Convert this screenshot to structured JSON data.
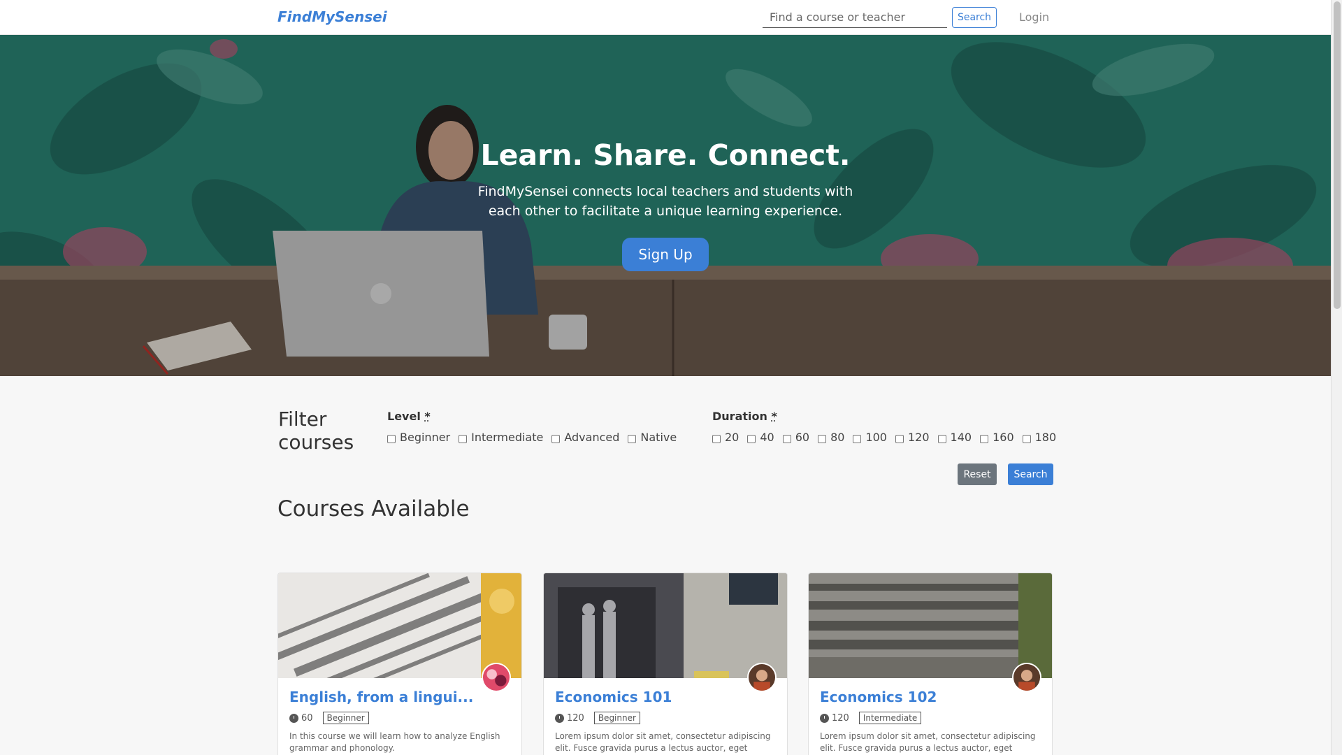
{
  "navbar": {
    "brand": "FindMySensei",
    "search_placeholder": "Find a course or teacher",
    "search_button": "Search",
    "login": "Login"
  },
  "hero": {
    "title": "Learn. Share. Connect.",
    "subtitle": "FindMySensei connects local teachers and students with each other to facilitate a unique learning experience.",
    "signup": "Sign Up"
  },
  "filter": {
    "title": "Filter courses",
    "level_label": "Level",
    "duration_label": "Duration",
    "required_mark": "*",
    "levels": [
      "Beginner",
      "Intermediate",
      "Advanced",
      "Native"
    ],
    "durations": [
      "20",
      "40",
      "60",
      "80",
      "100",
      "120",
      "140",
      "160",
      "180"
    ],
    "reset": "Reset",
    "search": "Search"
  },
  "courses": {
    "heading": "Courses Available",
    "items": [
      {
        "title": "English, from a lingui...",
        "duration": "60",
        "level": "Beginner",
        "description": "In this course we will learn how to analyze English grammar and phonology."
      },
      {
        "title": "Economics 101",
        "duration": "120",
        "level": "Beginner",
        "description": "Lorem ipsum dolor sit amet, consectetur adipiscing elit. Fusce gravida purus a lectus auctor, eget"
      },
      {
        "title": "Economics 102",
        "duration": "120",
        "level": "Intermediate",
        "description": "Lorem ipsum dolor sit amet, consectetur adipiscing elit. Fusce gravida purus a lectus auctor, eget"
      }
    ]
  },
  "colors": {
    "brand": "#3b7fd6",
    "secondary": "#6c757d"
  }
}
